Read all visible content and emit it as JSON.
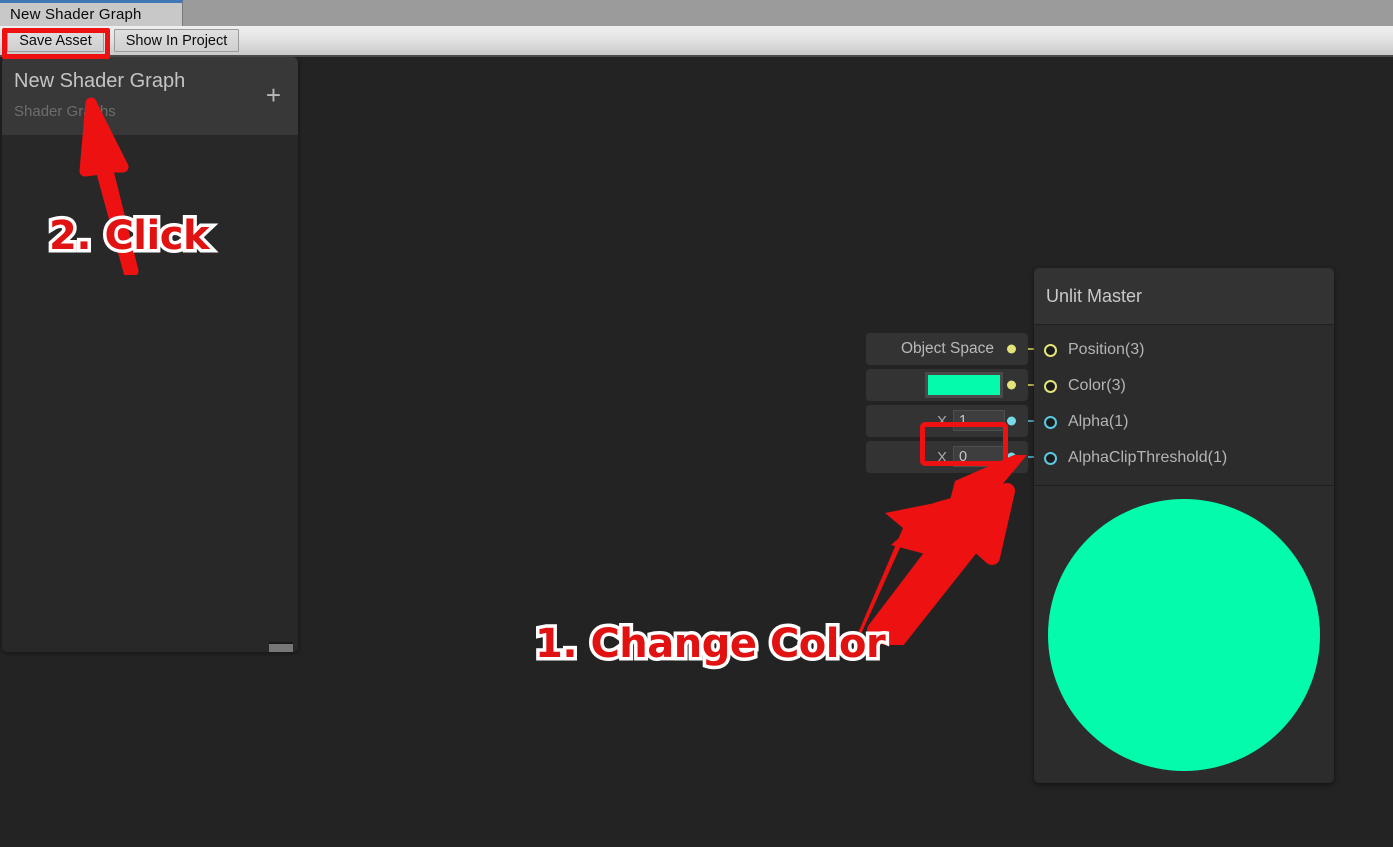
{
  "window": {
    "tab_label": "New Shader Graph"
  },
  "toolbar": {
    "save_asset_label": "Save Asset",
    "show_in_project_label": "Show In Project"
  },
  "blackboard": {
    "title": "New Shader Graph",
    "subtitle": "Shader Graphs",
    "add_label": "+"
  },
  "inputs": [
    {
      "type": "dropdown",
      "label": "Object Space",
      "port": "vec"
    },
    {
      "type": "color",
      "value": "#04FBAC",
      "port": "vec"
    },
    {
      "type": "number",
      "axis": "X",
      "value": "1",
      "port": "flt"
    },
    {
      "type": "number",
      "axis": "X",
      "value": "0",
      "port": "flt"
    }
  ],
  "master_node": {
    "title": "Unlit Master",
    "slots": [
      {
        "label": "Position(3)",
        "port": "vec"
      },
      {
        "label": "Color(3)",
        "port": "vec"
      },
      {
        "label": "Alpha(1)",
        "port": "flt"
      },
      {
        "label": "AlphaClipThreshold(1)",
        "port": "flt"
      }
    ],
    "preview_color": "#04FBAC"
  },
  "annotations": {
    "step1_label": "1. Change Color",
    "step2_label": "2. Click",
    "highlight_color": "#EE1111",
    "text_color": "#E11212",
    "outline_color": "#FFFFFF"
  },
  "colors": {
    "canvas_bg": "#232323",
    "panel_bg": "#282828",
    "panel_header_bg": "#383838",
    "vector_port": "#E3E37A",
    "float_port": "#5AC8E0",
    "accent_green": "#04FBAC"
  }
}
